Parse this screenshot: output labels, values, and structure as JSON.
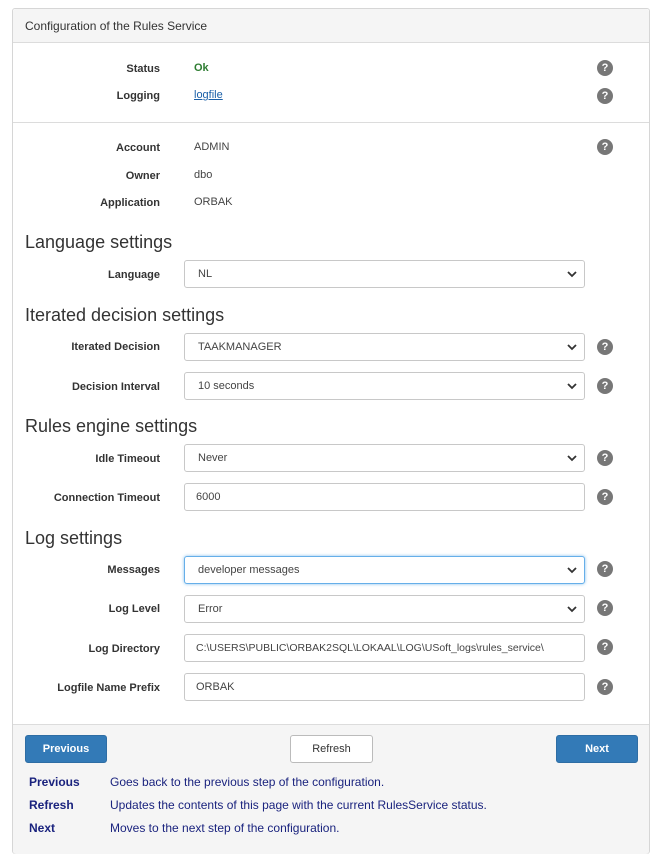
{
  "panel": {
    "title": "Configuration of the Rules Service"
  },
  "status": {
    "label": "Status",
    "value": "Ok",
    "color": "#2e7d32"
  },
  "logging": {
    "label": "Logging",
    "link": "logfile"
  },
  "account": {
    "label": "Account",
    "value": "ADMIN"
  },
  "owner": {
    "label": "Owner",
    "value": "dbo"
  },
  "application": {
    "label": "Application",
    "value": "ORBAK"
  },
  "help_icon": {
    "glyph": "?"
  },
  "sections": {
    "language": "Language settings",
    "iterated": "Iterated decision settings",
    "engine": "Rules engine settings",
    "log": "Log settings"
  },
  "fields": {
    "language": {
      "label": "Language",
      "value": "NL"
    },
    "iterated_decision": {
      "label": "Iterated Decision",
      "value": "TAAKMANAGER"
    },
    "decision_interval": {
      "label": "Decision Interval",
      "value": "10 seconds"
    },
    "idle_timeout": {
      "label": "Idle Timeout",
      "value": "Never"
    },
    "connection_timeout": {
      "label": "Connection Timeout",
      "value": "6000"
    },
    "messages": {
      "label": "Messages",
      "value": "developer messages"
    },
    "log_level": {
      "label": "Log Level",
      "value": "Error"
    },
    "log_directory": {
      "label": "Log Directory",
      "value": "C:\\USERS\\PUBLIC\\ORBAK2SQL\\LOKAAL\\LOG\\USoft_logs\\rules_service\\"
    },
    "logfile_prefix": {
      "label": "Logfile Name Prefix",
      "value": "ORBAK"
    }
  },
  "buttons": {
    "previous": "Previous",
    "refresh": "Refresh",
    "next": "Next"
  },
  "button_help": [
    {
      "key": "Previous",
      "desc": "Goes back to the previous step of the configuration."
    },
    {
      "key": "Refresh",
      "desc": "Updates the contents of this page with the current RulesService status."
    },
    {
      "key": "Next",
      "desc": "Moves to the next step of the configuration."
    }
  ],
  "colors": {
    "primary": "#337ab7",
    "help_text": "#1a237e",
    "link": "#1a5fa8"
  }
}
